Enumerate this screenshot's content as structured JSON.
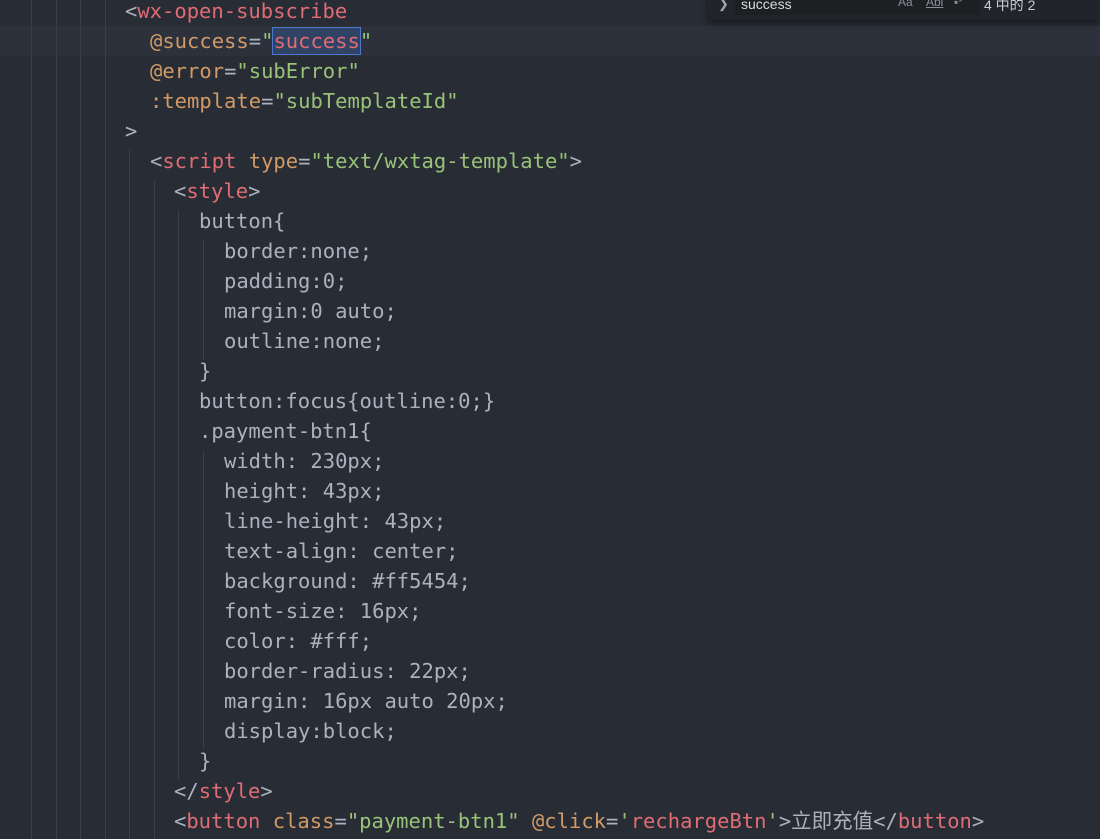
{
  "find_widget": {
    "query": "success",
    "match_case_label": "Aa",
    "whole_word_label": "Abl",
    "regex_label": "▪*",
    "count": "4 中的 2"
  },
  "code": {
    "l1": {
      "open": "<",
      "tag": "wx-open-subscribe"
    },
    "l2": {
      "attr": "@success",
      "eq": "=",
      "q1": "\"",
      "value": "success",
      "q2": "\""
    },
    "l3": {
      "attr": "@error",
      "eq": "=",
      "value": "\"subError\""
    },
    "l4": {
      "attr": ":template",
      "eq": "=",
      "value": "\"subTemplateId\""
    },
    "l5": {
      "close": ">"
    },
    "l6": {
      "open": "<",
      "tag": "script",
      "attr": "type",
      "eq": "=",
      "value": "\"text/wxtag-template\"",
      "close": ">"
    },
    "l7": {
      "open": "<",
      "tag": "style",
      "close": ">"
    },
    "l8": "button{",
    "l9": "border:none;",
    "l10": "padding:0;",
    "l11": "margin:0 auto;",
    "l12": "outline:none;",
    "l13": "}",
    "l14": "button:focus{outline:0;}",
    "l15": ".payment-btn1{",
    "l16": "width: 230px;",
    "l17": "height: 43px;",
    "l18": "line-height: 43px;",
    "l19": "text-align: center;",
    "l20": "background: #ff5454;",
    "l21": "font-size: 16px;",
    "l22": "color: #fff;",
    "l23": "border-radius: 22px;",
    "l24": "margin: 16px auto 20px;",
    "l25": "display:block;",
    "l26": "}",
    "l27": {
      "open": "</",
      "tag": "style",
      "close": ">"
    },
    "l28": {
      "open": "<",
      "tag": "button",
      "attr1": "class",
      "eq1": "=",
      "val1": "\"payment-btn1\"",
      "attr2": "@click",
      "eq2": "=",
      "q1": "'",
      "val2": "rechargeBtn",
      "q2": "'",
      "gt": ">",
      "text": "立即充值",
      "endopen": "</",
      "endtag": "button",
      "endclose": ">"
    }
  }
}
